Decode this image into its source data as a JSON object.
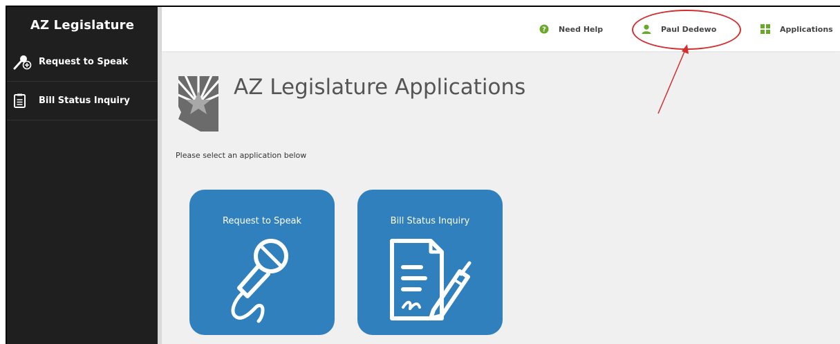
{
  "sidebar": {
    "title": "AZ Legislature",
    "items": [
      {
        "label": "Request to Speak",
        "icon": "microphone-plus-icon"
      },
      {
        "label": "Bill Status Inquiry",
        "icon": "document-list-icon"
      }
    ]
  },
  "topbar": {
    "help_label": "Need Help",
    "user_label": "Paul Dedewo",
    "apps_label": "Applications"
  },
  "main": {
    "title": "AZ Legislature Applications",
    "subtitle": "Please select an application below",
    "tiles": [
      {
        "label": "Request to Speak",
        "icon": "microphone-icon"
      },
      {
        "label": "Bill Status Inquiry",
        "icon": "document-pen-icon"
      }
    ]
  },
  "colors": {
    "sidebar_bg": "#1f1f1f",
    "tile_bg": "#2f80bd",
    "accent_green": "#6aa82a",
    "annotation_red": "#d32f2f"
  }
}
